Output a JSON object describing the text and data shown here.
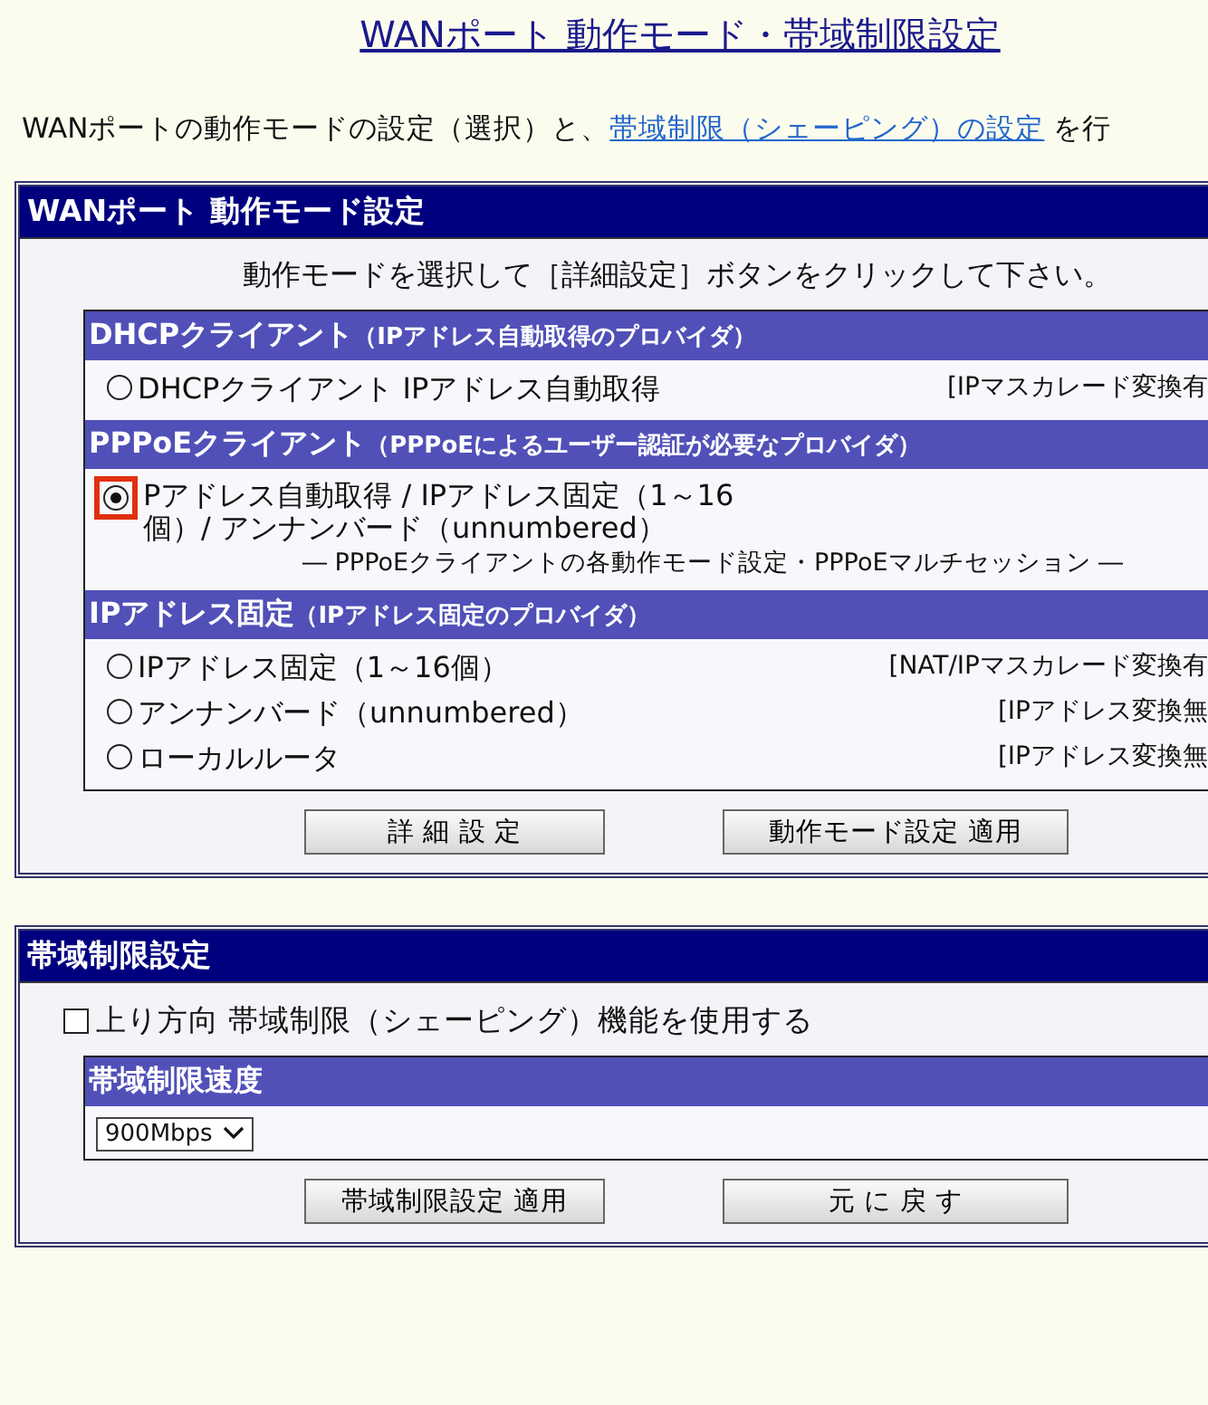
{
  "page_title": "WANポート 動作モード・帯域制限設定",
  "intro": {
    "text": "WANポートの動作モードの設定（選択）と、",
    "link": "帯域制限（シェーピング）の設定",
    "tail": "を行"
  },
  "mode_panel": {
    "title": "WANポート 動作モード設定",
    "instruction": "動作モードを選択して［詳細設定］ボタンをクリックして下さい。",
    "groups": [
      {
        "title": "DHCPクライアント",
        "note": "（IPアドレス自動取得のプロバイダ）",
        "options": [
          {
            "label": "DHCPクライアント IPアドレス自動取得",
            "tag": "[IPマスカレード変換有",
            "selected": false,
            "highlighted": false
          }
        ]
      },
      {
        "title": "PPPoEクライアント",
        "note": "（PPPoEによるユーザー認証が必要なプロバイダ）",
        "options": [
          {
            "label": "Pアドレス自動取得 / IPアドレス固定（1～16個）/ アンナンバード（unnumbered）",
            "sub": "― PPPoEクライアントの各動作モード設定・PPPoEマルチセッション ―",
            "selected": true,
            "highlighted": true
          }
        ]
      },
      {
        "title": "IPアドレス固定",
        "note": "（IPアドレス固定のプロバイダ）",
        "options": [
          {
            "label": "IPアドレス固定（1～16個）",
            "tag": "[NAT/IPマスカレード変換有",
            "selected": false,
            "highlighted": false
          },
          {
            "label": "アンナンバード（unnumbered）",
            "tag": "[IPアドレス変換無",
            "selected": false,
            "highlighted": false
          },
          {
            "label": "ローカルルータ",
            "tag": "[IPアドレス変換無",
            "selected": false,
            "highlighted": false
          }
        ]
      }
    ],
    "buttons": [
      "詳 細 設 定",
      "動作モード設定 適用"
    ]
  },
  "bandwidth_panel": {
    "title": "帯域制限設定",
    "checkbox": {
      "label": "上り方向 帯域制限（シェーピング）機能を使用する",
      "checked": false
    },
    "speed": {
      "title": "帯域制限速度",
      "value": "900Mbps"
    },
    "buttons": [
      "帯域制限設定 適用",
      "元 に 戻 す"
    ]
  }
}
